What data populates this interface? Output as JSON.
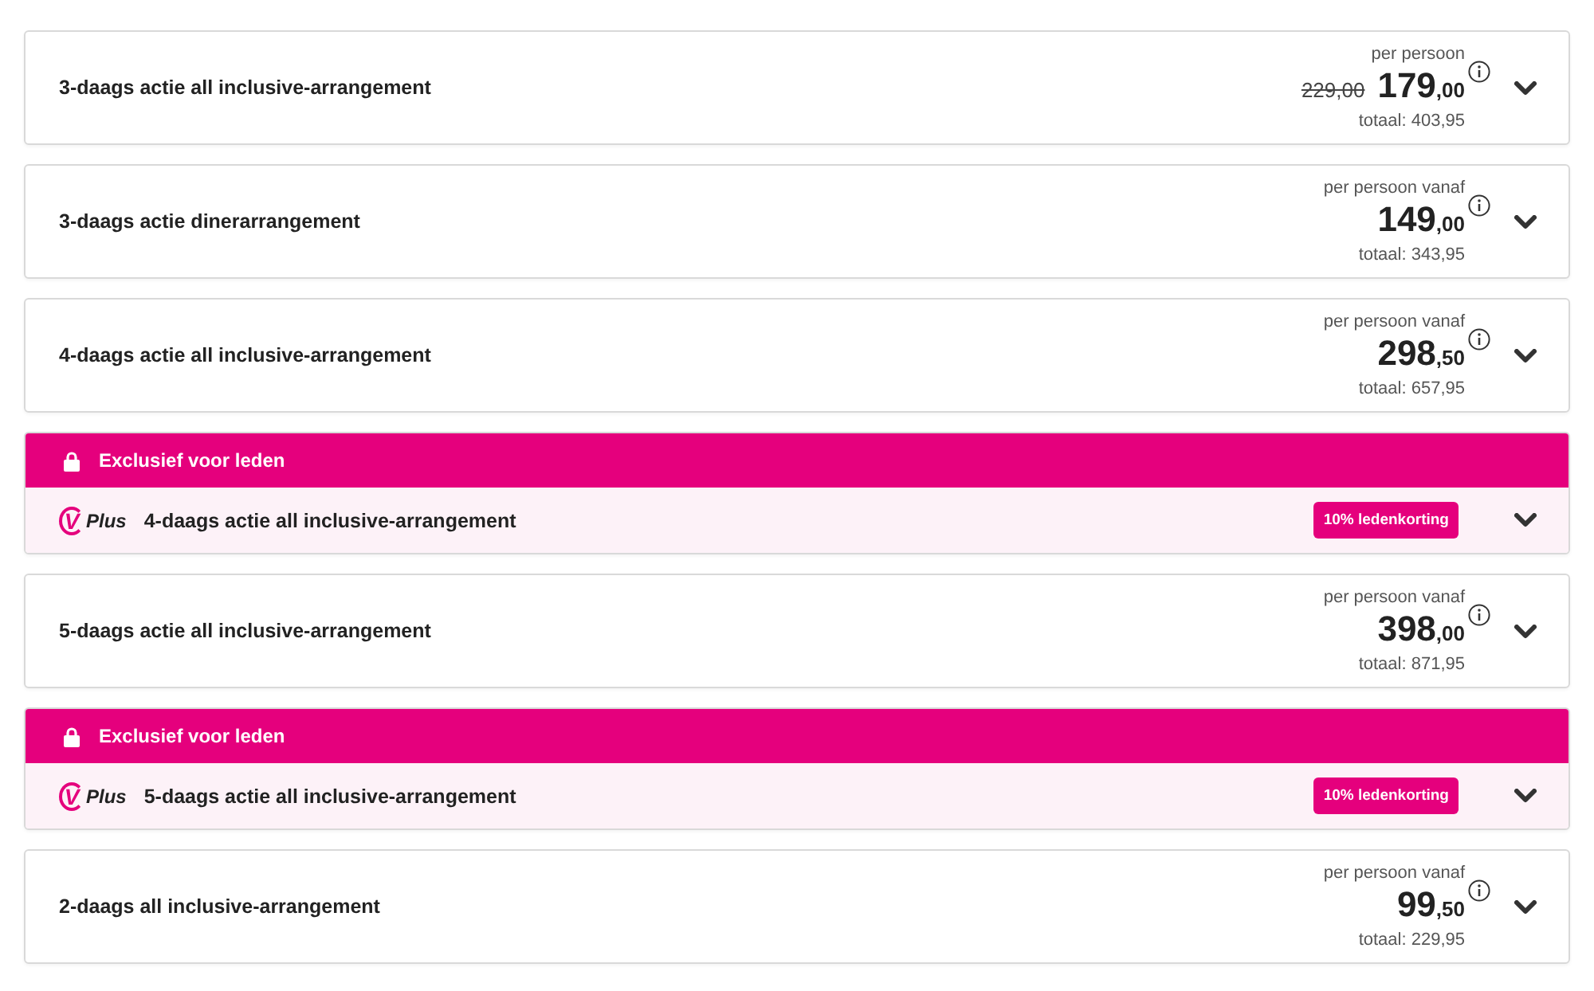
{
  "packages": [
    {
      "kind": "standard",
      "title": "3-daags actie all inclusive-arrangement",
      "price_label": "per persoon",
      "old_price": "229,00",
      "price_whole": "179",
      "price_fraction": ",00",
      "total": "totaal: 403,95",
      "expanded": false
    },
    {
      "kind": "standard",
      "title": "3-daags actie dinerarrangement",
      "price_label": "per persoon vanaf",
      "price_whole": "149",
      "price_fraction": ",00",
      "total": "totaal: 343,95",
      "expanded": false
    },
    {
      "kind": "standard",
      "title": "4-daags actie all inclusive-arrangement",
      "price_label": "per persoon vanaf",
      "price_whole": "298",
      "price_fraction": ",50",
      "total": "totaal: 657,95",
      "expanded": false
    },
    {
      "kind": "member",
      "banner": "Exclusief voor leden",
      "logo_mark": "V",
      "logo_text": "Plus",
      "title": "4-daags actie all inclusive-arrangement",
      "badge": "10% ledenkorting",
      "expanded": false
    },
    {
      "kind": "standard",
      "title": "5-daags actie all inclusive-arrangement",
      "price_label": "per persoon vanaf",
      "price_whole": "398",
      "price_fraction": ",00",
      "total": "totaal: 871,95",
      "expanded": false
    },
    {
      "kind": "member",
      "banner": "Exclusief voor leden",
      "logo_mark": "V",
      "logo_text": "Plus",
      "title": "5-daags actie all inclusive-arrangement",
      "badge": "10% ledenkorting",
      "expanded": false
    },
    {
      "kind": "standard",
      "title": "2-daags all inclusive-arrangement",
      "price_label": "per persoon vanaf",
      "price_whole": "99",
      "price_fraction": ",50",
      "total": "totaal: 229,95",
      "expanded": false
    }
  ]
}
